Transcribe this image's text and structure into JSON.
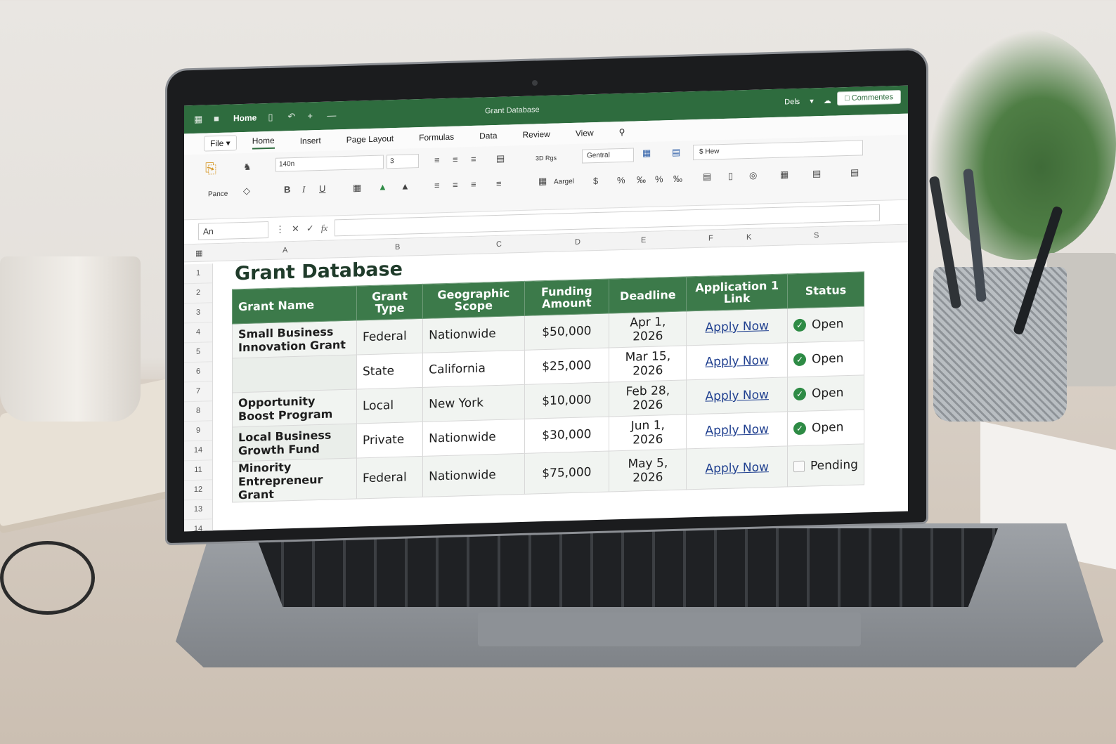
{
  "app": {
    "title_bar": {
      "home_label": "Home",
      "doc_title": "Grant Database",
      "user_label": "Dels"
    },
    "comments_label": "Commentes",
    "menu": {
      "file_label": "File",
      "tabs": [
        "Home",
        "Insert",
        "Page Layout",
        "Formulas",
        "Data",
        "Review",
        "View"
      ],
      "active_tab": "Home"
    },
    "ribbon": {
      "paste_label": "Pance",
      "font_name": "140n",
      "font_size": "3",
      "style_label": "3D Rgs",
      "merge_label": "Aargel",
      "number_format": "Gentral",
      "search_prefix": "$",
      "search_text": "Hew"
    },
    "formula_bar": {
      "name_box": "An"
    },
    "columns": [
      "A",
      "B",
      "C",
      "D",
      "E",
      "F",
      "K",
      "S"
    ],
    "row_numbers": [
      "1",
      "2",
      "3",
      "4",
      "5",
      "6",
      "7",
      "8",
      "9",
      "14",
      "11",
      "12",
      "13",
      "14"
    ]
  },
  "sheet": {
    "title": "Grant Database",
    "headers": [
      "Grant Name",
      "Grant Type",
      "Geographic Scope",
      "Funding Amount",
      "Deadline",
      "Application 1 Link",
      "Status"
    ],
    "rows": [
      {
        "name": "Small Business Innovation Grant",
        "type": "Federal",
        "scope": "Nationwide",
        "amount": "$50,000",
        "deadline": "Apr 1, 2026",
        "link": "Apply Now",
        "status": "Open"
      },
      {
        "name": "",
        "type": "State",
        "scope": "California",
        "amount": "$25,000",
        "deadline": "Mar 15, 2026",
        "link": "Apply Now",
        "status": "Open"
      },
      {
        "name": "Opportunity Boost Program",
        "type": "Local",
        "scope": "New York",
        "amount": "$10,000",
        "deadline": "Feb 28, 2026",
        "link": "Apply Now",
        "status": "Open"
      },
      {
        "name": "Local Business Growth Fund",
        "type": "Private",
        "scope": "Nationwide",
        "amount": "$30,000",
        "deadline": "Jun 1, 2026",
        "link": "Apply Now",
        "status": "Open"
      },
      {
        "name": "Minority Entrepreneur Grant",
        "type": "Federal",
        "scope": "Nationwide",
        "amount": "$75,000",
        "deadline": "May 5, 2026",
        "link": "Apply Now",
        "status": "Pending"
      }
    ]
  },
  "colors": {
    "brand_green": "#2e6c3e",
    "header_green": "#3c7a4a",
    "link_blue": "#1f3f8f",
    "status_open": "#2e8b45"
  }
}
